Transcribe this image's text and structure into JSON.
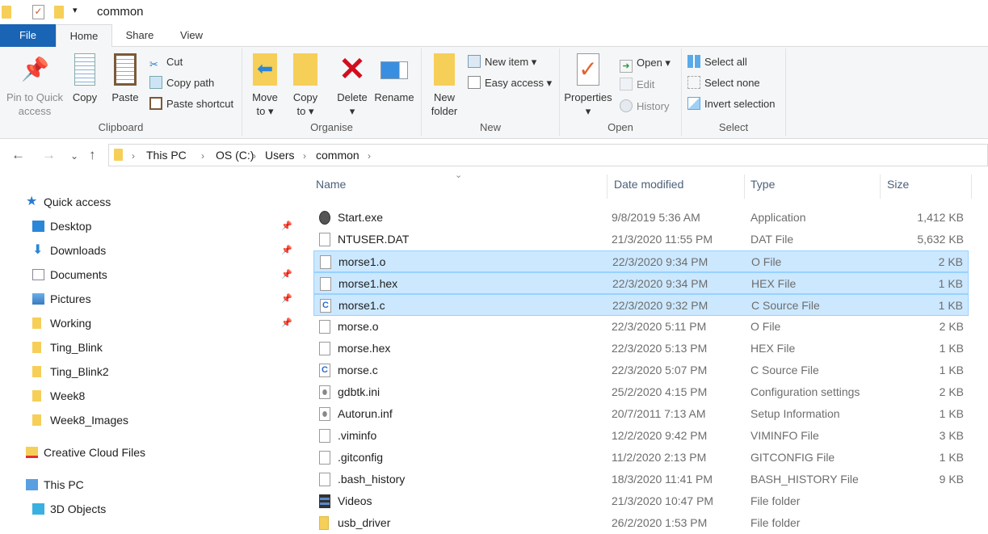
{
  "window": {
    "title": "common"
  },
  "tabs": [
    "File",
    "Home",
    "Share",
    "View"
  ],
  "ribbon": {
    "clipboard": {
      "label": "Clipboard",
      "pin": "Pin to Quick access",
      "pin1": "Pin to Quick",
      "pin2": "access",
      "copy": "Copy",
      "paste": "Paste",
      "cut": "Cut",
      "copy_path": "Copy path",
      "paste_shortcut": "Paste shortcut"
    },
    "organise": {
      "label": "Organise",
      "move1": "Move",
      "move2": "to",
      "copy1": "Copy",
      "copy2": "to",
      "delete": "Delete",
      "rename": "Rename"
    },
    "new": {
      "label": "New",
      "new1": "New",
      "new2": "folder",
      "new_item": "New item",
      "easy_access": "Easy access"
    },
    "open": {
      "label": "Open",
      "properties": "Properties",
      "open": "Open",
      "edit": "Edit",
      "history": "History"
    },
    "select": {
      "label": "Select",
      "all": "Select all",
      "none": "Select none",
      "invert": "Invert selection"
    }
  },
  "breadcrumb": [
    "This PC",
    "OS (C:)",
    "Users",
    "common"
  ],
  "nav": [
    {
      "label": "Quick access",
      "icon": "star-icon"
    },
    {
      "label": "Desktop",
      "icon": "desktop-icon",
      "pinned": true
    },
    {
      "label": "Downloads",
      "icon": "download-icon",
      "pinned": true
    },
    {
      "label": "Documents",
      "icon": "documents-icon",
      "pinned": true
    },
    {
      "label": "Pictures",
      "icon": "pictures-icon",
      "pinned": true
    },
    {
      "label": "Working",
      "icon": "folder-icon",
      "pinned": true
    },
    {
      "label": "Ting_Blink",
      "icon": "folder-icon"
    },
    {
      "label": "Ting_Blink2",
      "icon": "folder-icon"
    },
    {
      "label": "Week8",
      "icon": "folder-icon"
    },
    {
      "label": "Week8_Images",
      "icon": "folder-icon"
    },
    {
      "label": "Creative Cloud Files",
      "icon": "creative-cloud-icon"
    },
    {
      "label": "This PC",
      "icon": "computer-icon"
    },
    {
      "label": "3D Objects",
      "icon": "3d-objects-icon"
    }
  ],
  "columns": {
    "name": "Name",
    "date": "Date modified",
    "type": "Type",
    "size": "Size"
  },
  "files": [
    {
      "name": "Start.exe",
      "date": "9/8/2019 5:36 AM",
      "type": "Application",
      "size": "1,412 KB",
      "icon": "app-icon"
    },
    {
      "name": "NTUSER.DAT",
      "date": "21/3/2020 11:55 PM",
      "type": "DAT File",
      "size": "5,632 KB",
      "icon": "file-icon"
    },
    {
      "name": "morse1.o",
      "date": "22/3/2020 9:34 PM",
      "type": "O File",
      "size": "2 KB",
      "icon": "file-icon",
      "selected": true
    },
    {
      "name": "morse1.hex",
      "date": "22/3/2020 9:34 PM",
      "type": "HEX File",
      "size": "1 KB",
      "icon": "file-icon",
      "selected": true
    },
    {
      "name": "morse1.c",
      "date": "22/3/2020 9:32 PM",
      "type": "C Source File",
      "size": "1 KB",
      "icon": "c-file-icon",
      "selected": true
    },
    {
      "name": "morse.o",
      "date": "22/3/2020 5:11 PM",
      "type": "O File",
      "size": "2 KB",
      "icon": "file-icon"
    },
    {
      "name": "morse.hex",
      "date": "22/3/2020 5:13 PM",
      "type": "HEX File",
      "size": "1 KB",
      "icon": "file-icon"
    },
    {
      "name": "morse.c",
      "date": "22/3/2020 5:07 PM",
      "type": "C Source File",
      "size": "1 KB",
      "icon": "c-file-icon"
    },
    {
      "name": "gdbtk.ini",
      "date": "25/2/2020 4:15 PM",
      "type": "Configuration settings",
      "size": "2 KB",
      "icon": "settings-file-icon"
    },
    {
      "name": "Autorun.inf",
      "date": "20/7/2011 7:13 AM",
      "type": "Setup Information",
      "size": "1 KB",
      "icon": "settings-file-icon"
    },
    {
      "name": ".viminfo",
      "date": "12/2/2020 9:42 PM",
      "type": "VIMINFO File",
      "size": "3 KB",
      "icon": "file-icon"
    },
    {
      "name": ".gitconfig",
      "date": "11/2/2020 2:13 PM",
      "type": "GITCONFIG File",
      "size": "1 KB",
      "icon": "file-icon"
    },
    {
      "name": ".bash_history",
      "date": "18/3/2020 11:41 PM",
      "type": "BASH_HISTORY File",
      "size": "9 KB",
      "icon": "file-icon"
    },
    {
      "name": "Videos",
      "date": "21/3/2020 10:47 PM",
      "type": "File folder",
      "size": "",
      "icon": "videos-folder-icon"
    },
    {
      "name": "usb_driver",
      "date": "26/2/2020 1:53 PM",
      "type": "File folder",
      "size": "",
      "icon": "folder-icon"
    }
  ],
  "colors": {
    "accent": "#1964b4",
    "selection": "#cce8ff",
    "selection_border": "#99d1ff",
    "folder": "#f6cf58"
  }
}
